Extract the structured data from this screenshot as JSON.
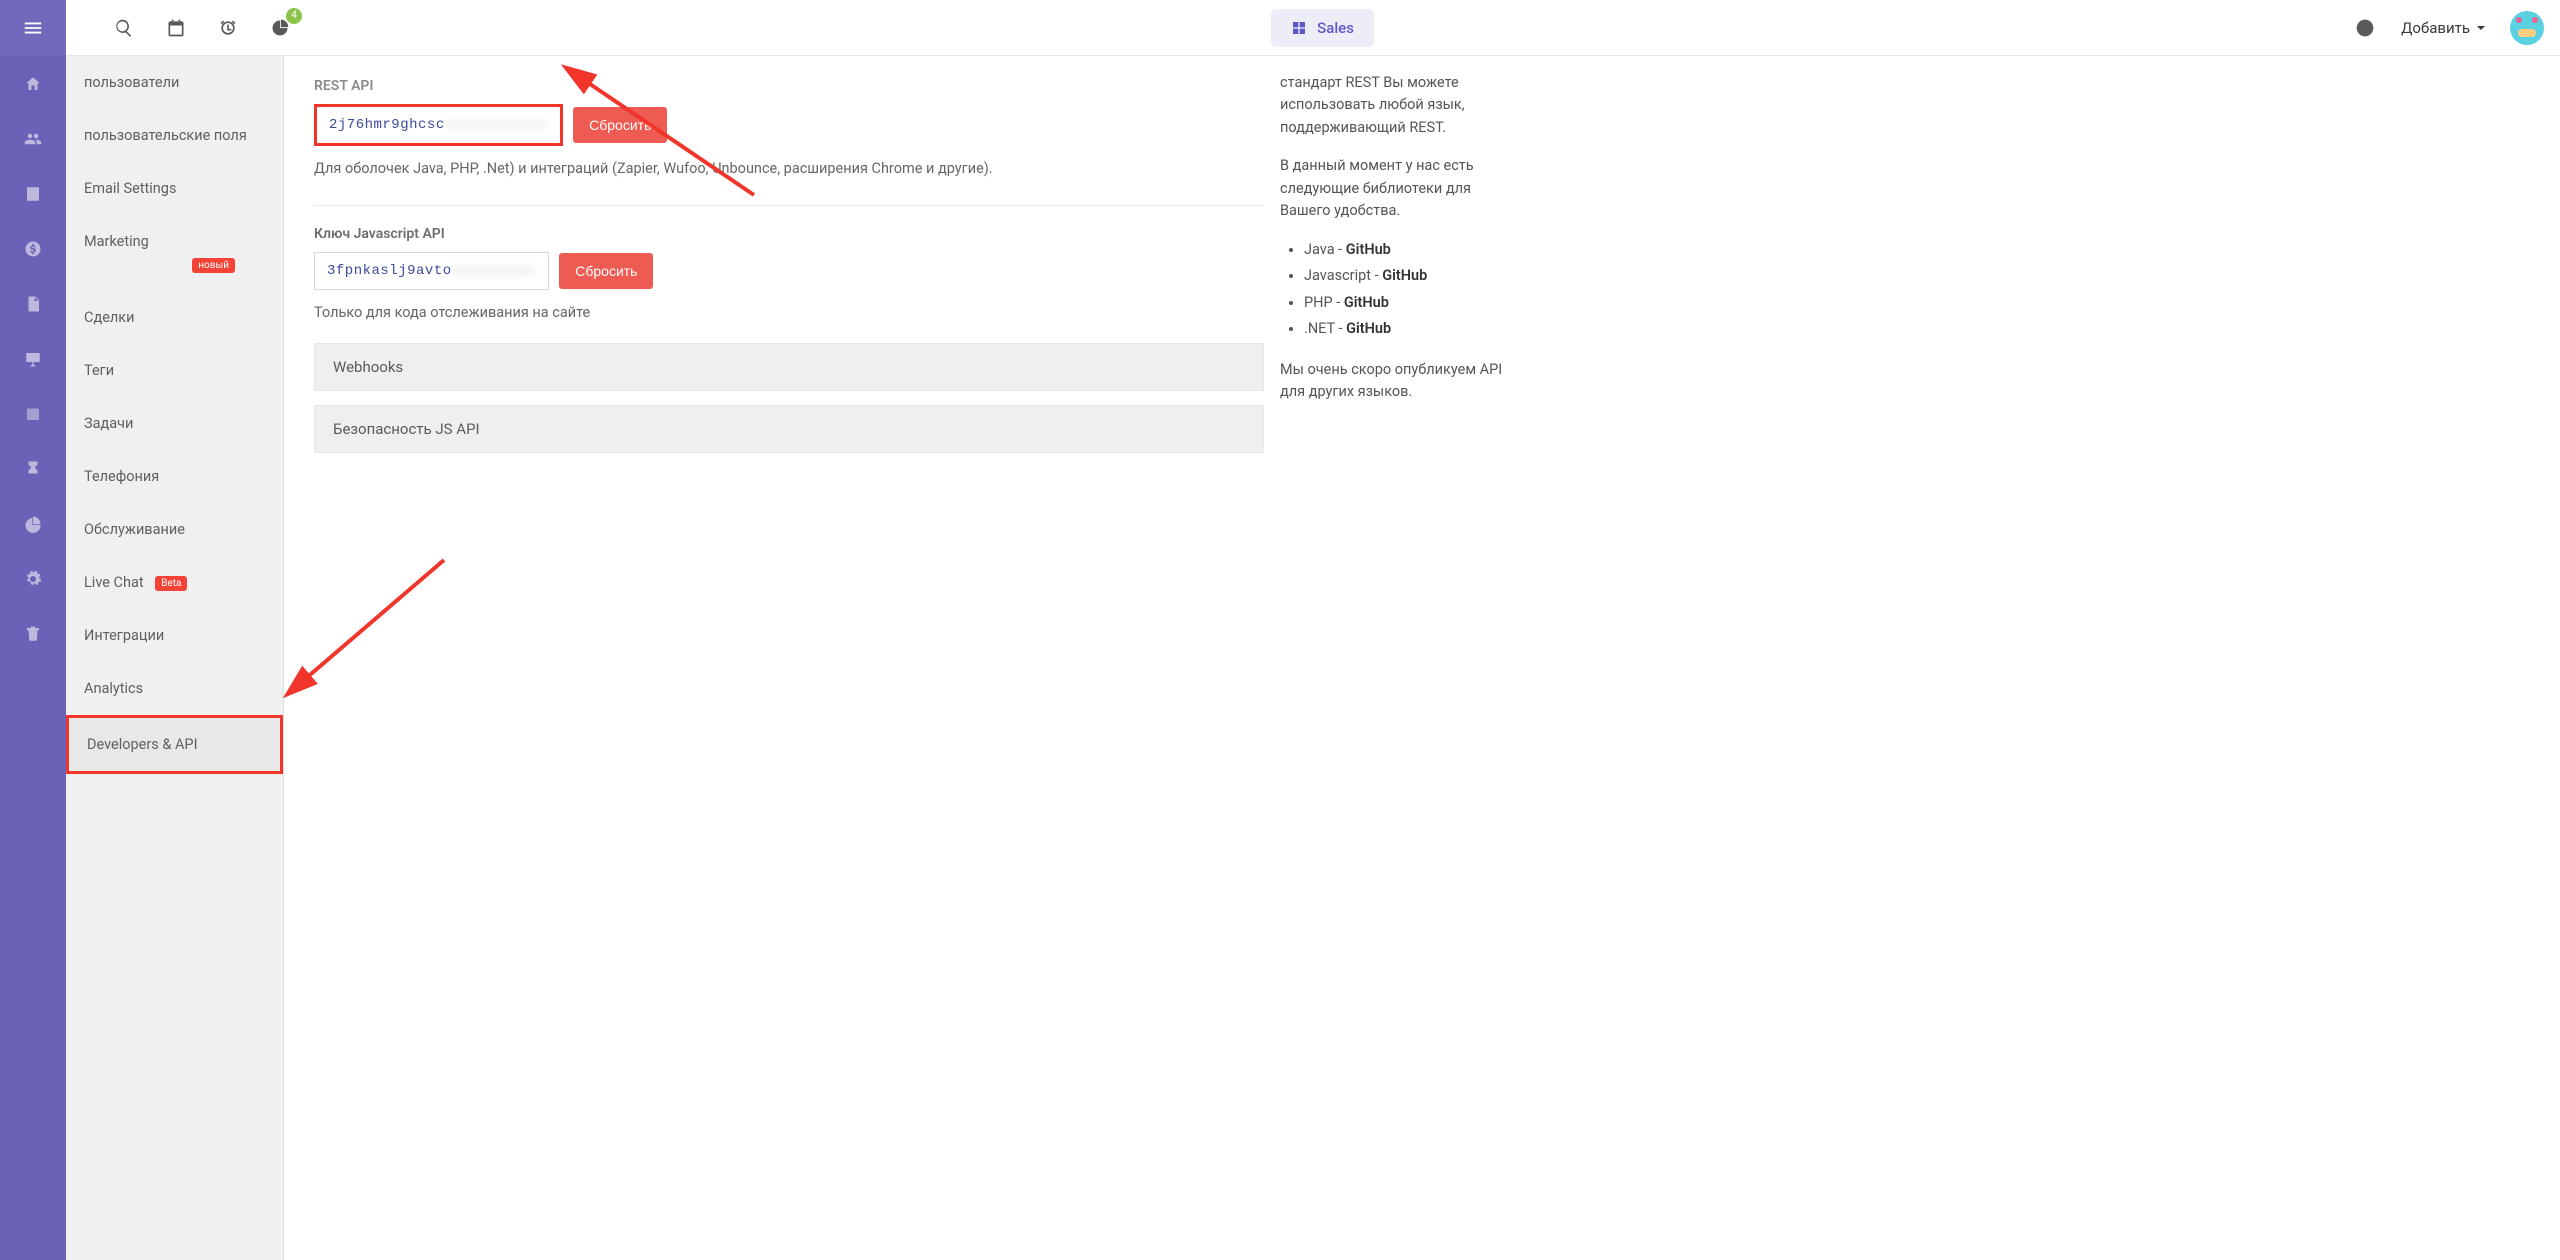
{
  "header": {
    "sales_label": "Sales",
    "add_label": "Добавить",
    "notif_count": "4"
  },
  "sidebar": {
    "items": [
      {
        "label": "пользователи"
      },
      {
        "label": "пользовательские поля"
      },
      {
        "label": "Email Settings"
      },
      {
        "label": "Marketing",
        "badge": "новый"
      },
      {
        "label": "Сделки"
      },
      {
        "label": "Теги"
      },
      {
        "label": "Задачи"
      },
      {
        "label": "Телефония"
      },
      {
        "label": "Обслуживание"
      },
      {
        "label": "Live Chat",
        "badge_beta": "Beta"
      },
      {
        "label": "Интеграции"
      },
      {
        "label": "Analytics"
      },
      {
        "label": "Developers & API",
        "selected": true
      }
    ]
  },
  "content": {
    "rest_api_label": "REST API",
    "rest_api_key": "2j76hmr9ghcsc",
    "rest_reset": "Сбросить",
    "rest_desc": "Для оболочек Java, PHP, .Net) и интеграций (Zapier, Wufoo, Unbounce, расширения Chrome и другие).",
    "js_api_label": "Ключ Javascript API",
    "js_api_key": "3fpnkaslj9avto",
    "js_reset": "Сбросить",
    "js_desc": "Только для кода отслеживания на сайте",
    "accordion_webhooks": "Webhooks",
    "accordion_jssec": "Безопасность JS API"
  },
  "info": {
    "p1a": "стандарт REST Вы можете использовать любой язык, поддерживающий REST.",
    "p2": "В данный момент у нас есть следующие библиотеки для Вашего удобства.",
    "lib_java_name": "Java - ",
    "lib_java_link": "GitHub",
    "lib_js_name": "Javascript - ",
    "lib_js_link": "GitHub",
    "lib_php_name": "PHP - ",
    "lib_php_link": "GitHub",
    "lib_net_name": ".NET - ",
    "lib_net_link": "GitHub",
    "p3": "Мы очень скоро опубликуем API для других языков."
  }
}
